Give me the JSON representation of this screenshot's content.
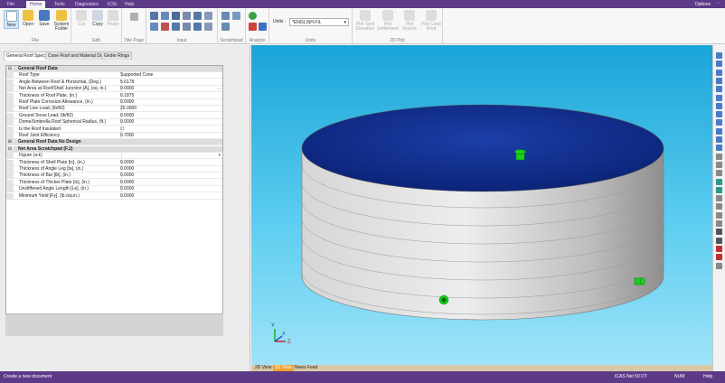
{
  "menu": {
    "tabs": [
      "File",
      "Home",
      "Tools",
      "Diagnostics",
      "ICSL",
      "Help"
    ],
    "options": "Options",
    "window_btn": "▫"
  },
  "ribbon": {
    "file": {
      "label": "File",
      "new": "New",
      "open": "Open",
      "save": "Save",
      "system": "System Folder"
    },
    "edit": {
      "label": "Edit",
      "cut": "Cut",
      "copy": "Copy",
      "paste": "Paste"
    },
    "title_page": {
      "label": "Title Page"
    },
    "input": {
      "label": "Input"
    },
    "scratchpad": {
      "label": "Scratchpad"
    },
    "analyze": {
      "label": "Analyze"
    },
    "units": {
      "label": "Units",
      "caption": "Units :",
      "value": "*ENGLISH.FIL"
    },
    "plot2d": {
      "label": "2D Plot",
      "items": [
        "Plot Tank Elevation",
        "Plot Settlement",
        "Plot Nozzle",
        "Plot Cone Roof"
      ]
    }
  },
  "tabs": [
    "General Roof Specs",
    "Cone Roof and Material Data",
    "Girder Rings"
  ],
  "grid": {
    "rows": [
      {
        "t": "hdr",
        "label": "General Roof Data",
        "gut": "⊟"
      },
      {
        "label": "Roof Type",
        "value": "Supported Cone"
      },
      {
        "label": "Angle Between Roof & Horizontal, (Deg.)",
        "value": "5.6178"
      },
      {
        "label": "Net Area at Roof/Shell Junction [A], (sq. in.)",
        "value": "0.0000",
        "ell": "..."
      },
      {
        "label": "Thickness of Roof Plate, (in.)",
        "value": "0.1875"
      },
      {
        "label": "Roof Plate Corrosion Allowance, (in.)",
        "value": "0.0000"
      },
      {
        "label": "Roof Live Load, (lb/ft2)",
        "value": "25.0000"
      },
      {
        "label": "Ground Snow Load, (lb/ft2)",
        "value": "0.0000"
      },
      {
        "label": "Dome/Umbrella Roof Spherical Radius, (ft.)",
        "value": "0.0000"
      },
      {
        "label": "Is the Roof Insulated",
        "value": "☐"
      },
      {
        "label": "Roof Joint Efficiency",
        "value": "0.7000"
      },
      {
        "t": "hdr",
        "label": "General Roof Data No Design",
        "gut": "⊞"
      },
      {
        "t": "hdr",
        "label": "Net Area Scratchpad (F.2)",
        "gut": "⊟"
      },
      {
        "label": "Figure (a-k)",
        "value": "",
        "ell": "▾"
      },
      {
        "label": "Thickness of Shell Plate [tc], (in.)",
        "value": "0.0000"
      },
      {
        "label": "Thickness of Angle Leg [ta], (in.)",
        "value": "0.0000"
      },
      {
        "label": "Thickness of Bar [tb], (in.)",
        "value": "0.0000"
      },
      {
        "label": "Thickness of Thicker Plate [ts], (in.)",
        "value": "0.0000"
      },
      {
        "label": "Unstiffened Angle Length [Le], (in.)",
        "value": "0.0000"
      },
      {
        "label": "Minimum Yield [Fy], (lb./sq.in.)",
        "value": "0.0000"
      }
    ]
  },
  "viewport": {
    "tabs": [
      "2D View",
      "3D View",
      "News Feed"
    ],
    "axes": {
      "y": "Y",
      "x": "X",
      "z": "Z"
    }
  },
  "status": {
    "message": "Create a new document",
    "version": "ICAS Net 50 DT",
    "num": "NUM",
    "help": "Help"
  },
  "colors": {
    "purple": "#5c3a88",
    "shell": "#c8c8c8",
    "roof": "#0d2a8a",
    "nozzle": "#19d019",
    "sky": "#1aa4d8"
  }
}
